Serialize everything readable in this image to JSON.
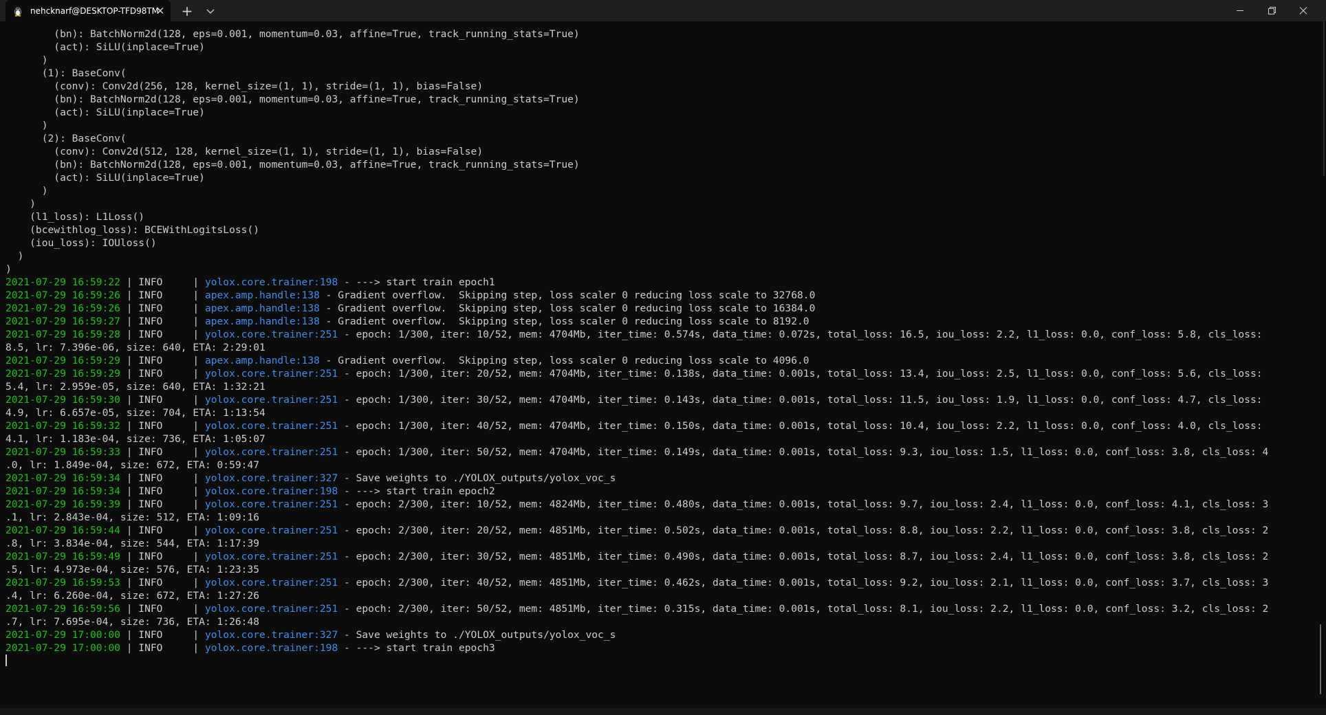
{
  "window": {
    "tab_title": "nehcknarf@DESKTOP-TFD98TM",
    "tab_icon": "linux-penguin-icon",
    "new_tab_icon": "plus-icon",
    "dropdown_icon": "chevron-down-icon",
    "controls": [
      "minimize-icon",
      "restore-icon",
      "close-icon"
    ]
  },
  "colors": {
    "background": "#0c0c0c",
    "text": "#cccccc",
    "timestamp": "#16c60c",
    "module": "#3b8eea"
  },
  "terminal": {
    "lines": [
      [
        {
          "t": "        (bn): BatchNorm2d(128, eps=0.001, momentum=0.03, affine=True, track_running_stats=True)"
        }
      ],
      [
        {
          "t": "        (act): SiLU(inplace=True)"
        }
      ],
      [
        {
          "t": "      )"
        }
      ],
      [
        {
          "t": "      (1): BaseConv("
        }
      ],
      [
        {
          "t": "        (conv): Conv2d(256, 128, kernel_size=(1, 1), stride=(1, 1), bias=False)"
        }
      ],
      [
        {
          "t": "        (bn): BatchNorm2d(128, eps=0.001, momentum=0.03, affine=True, track_running_stats=True)"
        }
      ],
      [
        {
          "t": "        (act): SiLU(inplace=True)"
        }
      ],
      [
        {
          "t": "      )"
        }
      ],
      [
        {
          "t": "      (2): BaseConv("
        }
      ],
      [
        {
          "t": "        (conv): Conv2d(512, 128, kernel_size=(1, 1), stride=(1, 1), bias=False)"
        }
      ],
      [
        {
          "t": "        (bn): BatchNorm2d(128, eps=0.001, momentum=0.03, affine=True, track_running_stats=True)"
        }
      ],
      [
        {
          "t": "        (act): SiLU(inplace=True)"
        }
      ],
      [
        {
          "t": "      )"
        }
      ],
      [
        {
          "t": "    )"
        }
      ],
      [
        {
          "t": "    (l1_loss): L1Loss()"
        }
      ],
      [
        {
          "t": "    (bcewithlog_loss): BCEWithLogitsLoss()"
        }
      ],
      [
        {
          "t": "    (iou_loss): IOUloss()"
        }
      ],
      [
        {
          "t": "  )"
        }
      ],
      [
        {
          "t": ")"
        }
      ],
      [
        {
          "t": "2021-07-29 16:59:22",
          "c": "ts"
        },
        {
          "t": " | INFO     | "
        },
        {
          "t": "yolox.core.trainer:198",
          "c": "mod"
        },
        {
          "t": " - ---> start train epoch1"
        }
      ],
      [
        {
          "t": "2021-07-29 16:59:26",
          "c": "ts"
        },
        {
          "t": " | INFO     | "
        },
        {
          "t": "apex.amp.handle:138",
          "c": "mod"
        },
        {
          "t": " - Gradient overflow.  Skipping step, loss scaler 0 reducing loss scale to 32768.0"
        }
      ],
      [
        {
          "t": "2021-07-29 16:59:26",
          "c": "ts"
        },
        {
          "t": " | INFO     | "
        },
        {
          "t": "apex.amp.handle:138",
          "c": "mod"
        },
        {
          "t": " - Gradient overflow.  Skipping step, loss scaler 0 reducing loss scale to 16384.0"
        }
      ],
      [
        {
          "t": "2021-07-29 16:59:27",
          "c": "ts"
        },
        {
          "t": " | INFO     | "
        },
        {
          "t": "apex.amp.handle:138",
          "c": "mod"
        },
        {
          "t": " - Gradient overflow.  Skipping step, loss scaler 0 reducing loss scale to 8192.0"
        }
      ],
      [
        {
          "t": "2021-07-29 16:59:28",
          "c": "ts"
        },
        {
          "t": " | INFO     | "
        },
        {
          "t": "yolox.core.trainer:251",
          "c": "mod"
        },
        {
          "t": " - epoch: 1/300, iter: 10/52, mem: 4704Mb, iter_time: 0.574s, data_time: 0.072s, total_loss: 16.5, iou_loss: 2.2, l1_loss: 0.0, conf_loss: 5.8, cls_loss:"
        }
      ],
      [
        {
          "t": "8.5, lr: 7.396e-06, size: 640, ETA: 2:29:01"
        }
      ],
      [
        {
          "t": "2021-07-29 16:59:29",
          "c": "ts"
        },
        {
          "t": " | INFO     | "
        },
        {
          "t": "apex.amp.handle:138",
          "c": "mod"
        },
        {
          "t": " - Gradient overflow.  Skipping step, loss scaler 0 reducing loss scale to 4096.0"
        }
      ],
      [
        {
          "t": "2021-07-29 16:59:29",
          "c": "ts"
        },
        {
          "t": " | INFO     | "
        },
        {
          "t": "yolox.core.trainer:251",
          "c": "mod"
        },
        {
          "t": " - epoch: 1/300, iter: 20/52, mem: 4704Mb, iter_time: 0.138s, data_time: 0.001s, total_loss: 13.4, iou_loss: 2.5, l1_loss: 0.0, conf_loss: 5.6, cls_loss:"
        }
      ],
      [
        {
          "t": "5.4, lr: 2.959e-05, size: 640, ETA: 1:32:21"
        }
      ],
      [
        {
          "t": "2021-07-29 16:59:30",
          "c": "ts"
        },
        {
          "t": " | INFO     | "
        },
        {
          "t": "yolox.core.trainer:251",
          "c": "mod"
        },
        {
          "t": " - epoch: 1/300, iter: 30/52, mem: 4704Mb, iter_time: 0.143s, data_time: 0.001s, total_loss: 11.5, iou_loss: 1.9, l1_loss: 0.0, conf_loss: 4.7, cls_loss:"
        }
      ],
      [
        {
          "t": "4.9, lr: 6.657e-05, size: 704, ETA: 1:13:54"
        }
      ],
      [
        {
          "t": "2021-07-29 16:59:32",
          "c": "ts"
        },
        {
          "t": " | INFO     | "
        },
        {
          "t": "yolox.core.trainer:251",
          "c": "mod"
        },
        {
          "t": " - epoch: 1/300, iter: 40/52, mem: 4704Mb, iter_time: 0.150s, data_time: 0.001s, total_loss: 10.4, iou_loss: 2.2, l1_loss: 0.0, conf_loss: 4.0, cls_loss:"
        }
      ],
      [
        {
          "t": "4.1, lr: 1.183e-04, size: 736, ETA: 1:05:07"
        }
      ],
      [
        {
          "t": "2021-07-29 16:59:33",
          "c": "ts"
        },
        {
          "t": " | INFO     | "
        },
        {
          "t": "yolox.core.trainer:251",
          "c": "mod"
        },
        {
          "t": " - epoch: 1/300, iter: 50/52, mem: 4704Mb, iter_time: 0.149s, data_time: 0.001s, total_loss: 9.3, iou_loss: 1.5, l1_loss: 0.0, conf_loss: 3.8, cls_loss: 4"
        }
      ],
      [
        {
          "t": ".0, lr: 1.849e-04, size: 672, ETA: 0:59:47"
        }
      ],
      [
        {
          "t": "2021-07-29 16:59:34",
          "c": "ts"
        },
        {
          "t": " | INFO     | "
        },
        {
          "t": "yolox.core.trainer:327",
          "c": "mod"
        },
        {
          "t": " - Save weights to ./YOLOX_outputs/yolox_voc_s"
        }
      ],
      [
        {
          "t": "2021-07-29 16:59:34",
          "c": "ts"
        },
        {
          "t": " | INFO     | "
        },
        {
          "t": "yolox.core.trainer:198",
          "c": "mod"
        },
        {
          "t": " - ---> start train epoch2"
        }
      ],
      [
        {
          "t": "2021-07-29 16:59:39",
          "c": "ts"
        },
        {
          "t": " | INFO     | "
        },
        {
          "t": "yolox.core.trainer:251",
          "c": "mod"
        },
        {
          "t": " - epoch: 2/300, iter: 10/52, mem: 4824Mb, iter_time: 0.480s, data_time: 0.001s, total_loss: 9.7, iou_loss: 2.4, l1_loss: 0.0, conf_loss: 4.1, cls_loss: 3"
        }
      ],
      [
        {
          "t": ".1, lr: 2.843e-04, size: 512, ETA: 1:09:16"
        }
      ],
      [
        {
          "t": "2021-07-29 16:59:44",
          "c": "ts"
        },
        {
          "t": " | INFO     | "
        },
        {
          "t": "yolox.core.trainer:251",
          "c": "mod"
        },
        {
          "t": " - epoch: 2/300, iter: 20/52, mem: 4851Mb, iter_time: 0.502s, data_time: 0.001s, total_loss: 8.8, iou_loss: 2.2, l1_loss: 0.0, conf_loss: 3.8, cls_loss: 2"
        }
      ],
      [
        {
          "t": ".8, lr: 3.834e-04, size: 544, ETA: 1:17:39"
        }
      ],
      [
        {
          "t": "2021-07-29 16:59:49",
          "c": "ts"
        },
        {
          "t": " | INFO     | "
        },
        {
          "t": "yolox.core.trainer:251",
          "c": "mod"
        },
        {
          "t": " - epoch: 2/300, iter: 30/52, mem: 4851Mb, iter_time: 0.490s, data_time: 0.001s, total_loss: 8.7, iou_loss: 2.4, l1_loss: 0.0, conf_loss: 3.8, cls_loss: 2"
        }
      ],
      [
        {
          "t": ".5, lr: 4.973e-04, size: 576, ETA: 1:23:35"
        }
      ],
      [
        {
          "t": "2021-07-29 16:59:53",
          "c": "ts"
        },
        {
          "t": " | INFO     | "
        },
        {
          "t": "yolox.core.trainer:251",
          "c": "mod"
        },
        {
          "t": " - epoch: 2/300, iter: 40/52, mem: 4851Mb, iter_time: 0.462s, data_time: 0.001s, total_loss: 9.2, iou_loss: 2.1, l1_loss: 0.0, conf_loss: 3.7, cls_loss: 3"
        }
      ],
      [
        {
          "t": ".4, lr: 6.260e-04, size: 672, ETA: 1:27:26"
        }
      ],
      [
        {
          "t": "2021-07-29 16:59:56",
          "c": "ts"
        },
        {
          "t": " | INFO     | "
        },
        {
          "t": "yolox.core.trainer:251",
          "c": "mod"
        },
        {
          "t": " - epoch: 2/300, iter: 50/52, mem: 4851Mb, iter_time: 0.315s, data_time: 0.001s, total_loss: 8.1, iou_loss: 2.2, l1_loss: 0.0, conf_loss: 3.2, cls_loss: 2"
        }
      ],
      [
        {
          "t": ".7, lr: 7.695e-04, size: 736, ETA: 1:26:48"
        }
      ],
      [
        {
          "t": "2021-07-29 17:00:00",
          "c": "ts"
        },
        {
          "t": " | INFO     | "
        },
        {
          "t": "yolox.core.trainer:327",
          "c": "mod"
        },
        {
          "t": " - Save weights to ./YOLOX_outputs/yolox_voc_s"
        }
      ],
      [
        {
          "t": "2021-07-29 17:00:00",
          "c": "ts"
        },
        {
          "t": " | INFO     | "
        },
        {
          "t": "yolox.core.trainer:198",
          "c": "mod"
        },
        {
          "t": " - ---> start train epoch3"
        }
      ]
    ]
  }
}
